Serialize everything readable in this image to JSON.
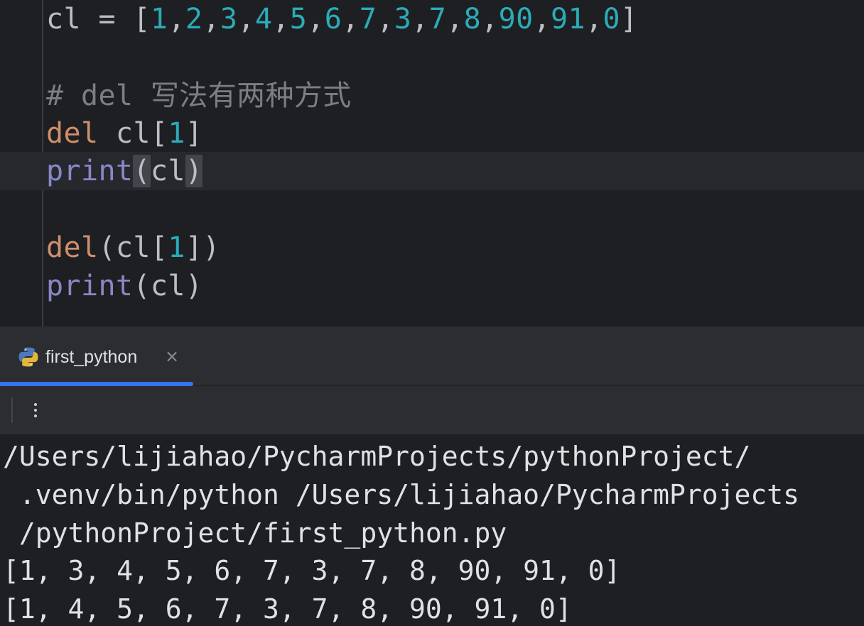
{
  "editor": {
    "lines": {
      "l1": {
        "var": "cl",
        "op": " = ",
        "open": "[",
        "nums": [
          "1",
          "2",
          "3",
          "4",
          "5",
          "6",
          "7",
          "3",
          "7",
          "8",
          "90",
          "91",
          "0"
        ],
        "close": "]"
      },
      "l3": {
        "comment": "# del ",
        "comment_cjk": "写法有两种方式"
      },
      "l4": {
        "kw": "del",
        "rest": " cl[",
        "num": "1",
        "close": "]"
      },
      "l5": {
        "fn": "print",
        "open": "(",
        "arg": "cl",
        "close": ")"
      },
      "l7": {
        "kw": "del",
        "open": "(cl[",
        "num": "1",
        "close": "])"
      },
      "l8": {
        "fn": "print",
        "rest": "(cl)"
      }
    }
  },
  "run_panel": {
    "tab_label": "first_python",
    "tab_icon": "python-icon",
    "close_glyph": "×",
    "more_icon": "more-vertical-icon"
  },
  "console": {
    "lines": [
      "/Users/lijiahao/PycharmProjects/pythonProject/",
      " .venv/bin/python /Users/lijiahao/PycharmProjects",
      " /pythonProject/first_python.py",
      "[1, 3, 4, 5, 6, 7, 3, 7, 8, 90, 91, 0]",
      "[1, 4, 5, 6, 7, 3, 7, 8, 90, 91, 0]"
    ]
  },
  "colors": {
    "background": "#1e1f22",
    "panel": "#2b2d30",
    "number": "#2aacb8",
    "keyword": "#cf8e6d",
    "builtin": "#8888c6",
    "comment": "#7a7e85",
    "tab_accent": "#3574f0"
  }
}
